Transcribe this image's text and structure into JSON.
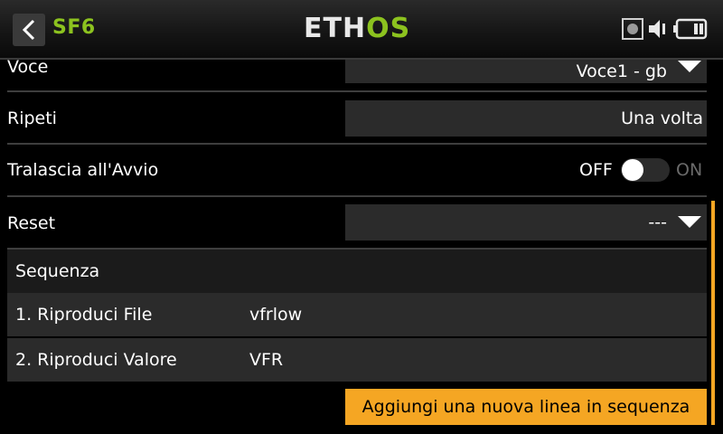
{
  "header": {
    "title": "SF6",
    "logo_main": "ETH",
    "logo_accent": "OS",
    "back_icon": "chevron-left-icon",
    "status_icons": [
      "record-icon",
      "speaker-icon",
      "battery-icon"
    ]
  },
  "rows": {
    "voice": {
      "label": "Voce",
      "value": "Voce1 - gb"
    },
    "repeat": {
      "label": "Ripeti",
      "value": "Una volta"
    },
    "skip_startup": {
      "label": "Tralascia all'Avvio",
      "off": "OFF",
      "on": "ON",
      "state": "off"
    },
    "reset": {
      "label": "Reset",
      "value": "---"
    }
  },
  "sequence": {
    "title": "Sequenza",
    "items": [
      {
        "name": "1. Riproduci File",
        "value": "vfrlow"
      },
      {
        "name": "2. Riproduci Valore",
        "value": "VFR"
      }
    ],
    "add_label": "Aggiungi una nuova linea in sequenza"
  },
  "colors": {
    "accent_green": "#8cc21f",
    "accent_orange": "#f5a623",
    "field_bg": "#2b2b2b"
  }
}
